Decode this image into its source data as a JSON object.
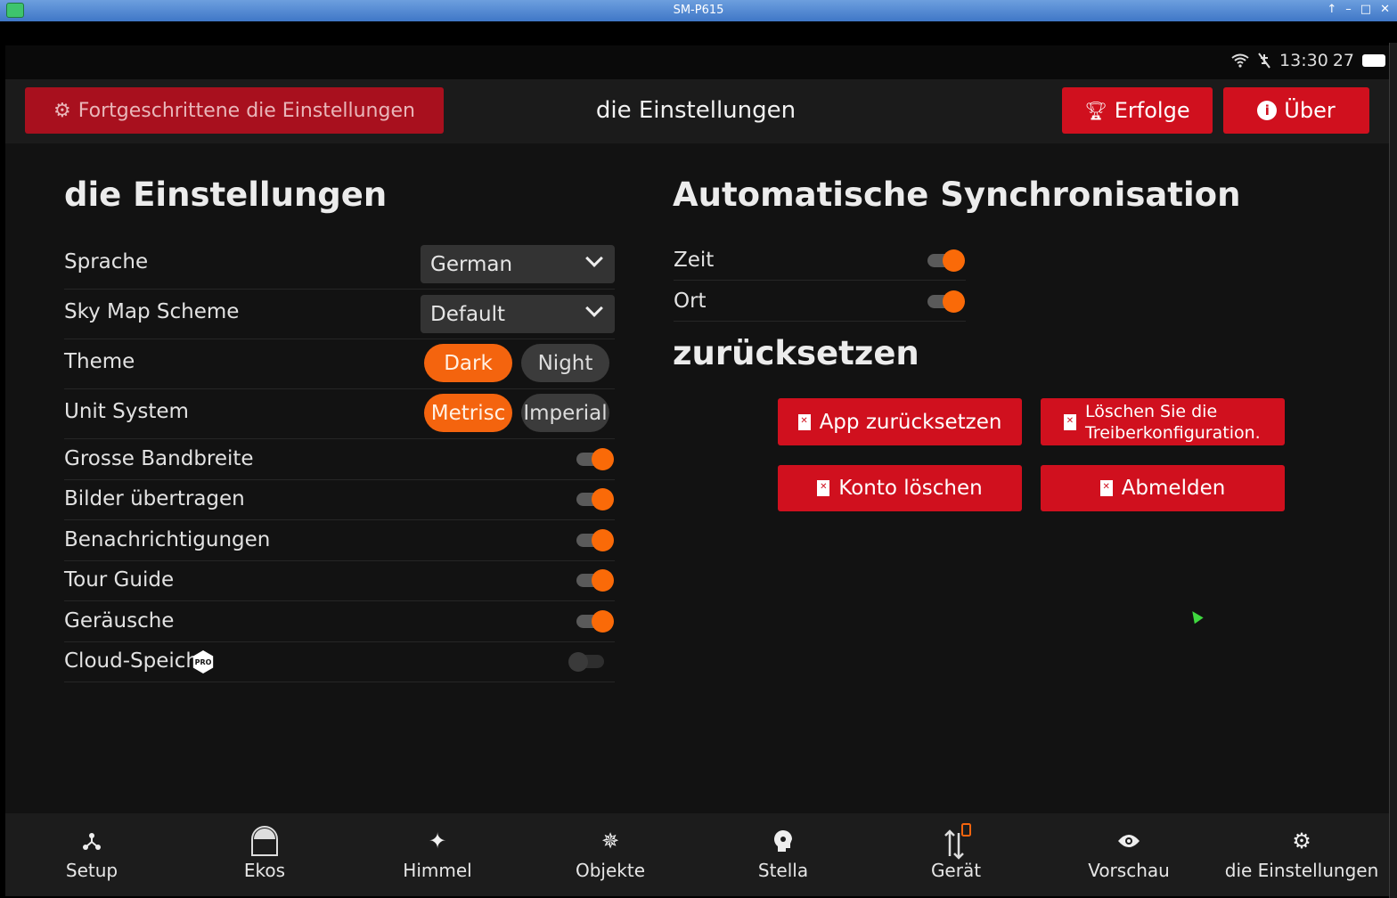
{
  "window": {
    "title": "SM-P615"
  },
  "status": {
    "time": "13:30",
    "battery": "27"
  },
  "header": {
    "advanced_label": "Fortgeschrittene die Einstellungen",
    "title": "die Einstellungen",
    "achievements_label": "Erfolge",
    "about_label": "Über"
  },
  "settings": {
    "heading": "die Einstellungen",
    "language": {
      "label": "Sprache",
      "value": "German"
    },
    "skymap": {
      "label": "Sky Map Scheme",
      "value": "Default"
    },
    "theme": {
      "label": "Theme",
      "options": [
        "Dark",
        "Night"
      ],
      "selected": "Dark"
    },
    "units": {
      "label": "Unit System",
      "options": [
        "Metrisc",
        "Imperial"
      ],
      "selected": "Metrisc"
    },
    "toggles": [
      {
        "label": "Grosse Bandbreite",
        "on": true
      },
      {
        "label": "Bilder übertragen",
        "on": true
      },
      {
        "label": "Benachrichtigungen",
        "on": true
      },
      {
        "label": "Tour Guide",
        "on": true
      },
      {
        "label": "Geräusche",
        "on": true
      },
      {
        "label": "Cloud-Speich",
        "on": false,
        "badge": "PRO"
      }
    ]
  },
  "sync": {
    "heading": "Automatische Synchronisation",
    "items": [
      {
        "label": "Zeit",
        "on": true
      },
      {
        "label": "Ort",
        "on": true
      }
    ]
  },
  "reset": {
    "heading": "zurücksetzen",
    "app_reset": "App zurücksetzen",
    "driver_reset": "Löschen Sie die Treiberkonfiguration.",
    "delete_account": "Konto löschen",
    "logout": "Abmelden"
  },
  "nav": [
    {
      "label": "Setup",
      "icon": "setup-icon"
    },
    {
      "label": "Ekos",
      "icon": "ekos-icon"
    },
    {
      "label": "Himmel",
      "icon": "sparkles-icon"
    },
    {
      "label": "Objekte",
      "icon": "objects-icon"
    },
    {
      "label": "Stella",
      "icon": "stella-icon"
    },
    {
      "label": "Gerät",
      "icon": "device-icon"
    },
    {
      "label": "Vorschau",
      "icon": "eye-icon"
    },
    {
      "label": "die Einstellungen",
      "icon": "gear-icon"
    }
  ],
  "colors": {
    "accent": "#f4640e",
    "danger": "#d0101e",
    "background": "#121212"
  }
}
